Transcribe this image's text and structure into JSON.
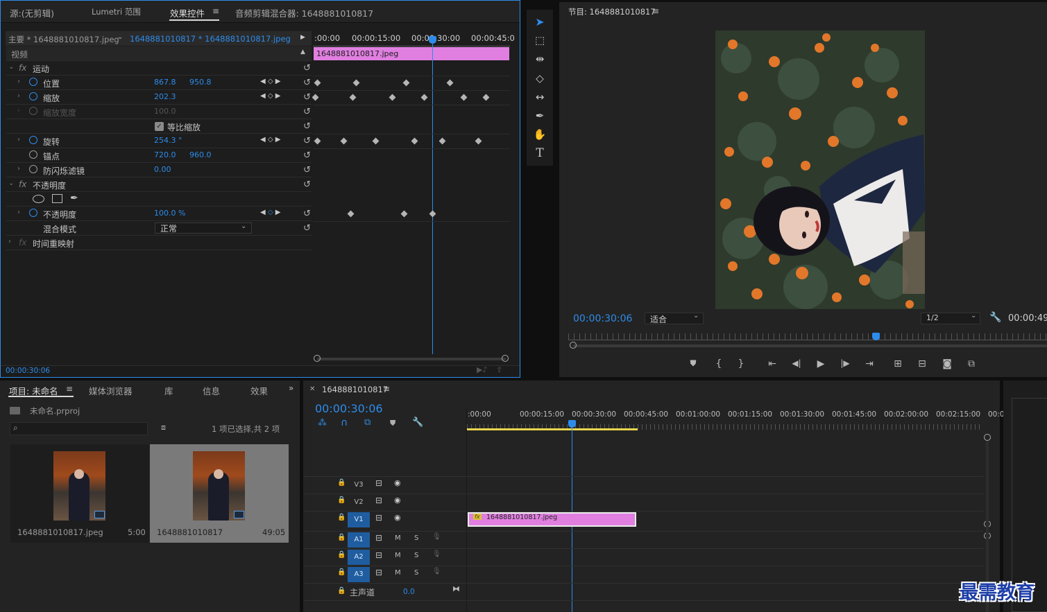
{
  "effect_panel": {
    "tabs": [
      "源:(无剪辑)",
      "Lumetri 范围",
      "效果控件",
      "音频剪辑混合器: 1648881010817"
    ],
    "active_tab": "效果控件",
    "master_label": "主要 * 1648881010817.jpeg",
    "clip_select": "1648881010817 * 1648881010817.jpeg",
    "ruler_ticks": [
      ":00:00",
      "00:00:15:00",
      "00:00:30:00",
      "00:00:45:0"
    ],
    "clip_bar": "1648881010817.jpeg",
    "video_label": "视频",
    "motion_label": "运动",
    "position_label": "位置",
    "position_x": "867.8",
    "position_y": "950.8",
    "scale_label": "缩放",
    "scale_value": "202.3",
    "scale_width_label": "缩放宽度",
    "scale_width_value": "100.0",
    "uniform_label": "等比缩放",
    "rotation_label": "旋转",
    "rotation_value": "254.3 °",
    "anchor_label": "锚点",
    "anchor_x": "720.0",
    "anchor_y": "960.0",
    "flicker_label": "防闪烁滤镜",
    "flicker_value": "0.00",
    "opacity_group": "不透明度",
    "opacity_label": "不透明度",
    "opacity_value": "100.0 %",
    "blend_label": "混合模式",
    "blend_value": "正常",
    "time_remap_label": "时间重映射",
    "timecode": "00:00:30:06"
  },
  "program_monitor": {
    "title": "节目: 1648881010817",
    "timecode": "00:00:30:06",
    "fit": "适合",
    "resolution": "1/2",
    "duration": "00:00:49"
  },
  "project_panel": {
    "tabs": [
      "项目: 未命名",
      "媒体浏览器",
      "库",
      "信息",
      "效果"
    ],
    "project_file": "未命名.prproj",
    "selection_info": "1 项已选择,共 2 项",
    "items": [
      {
        "name": "1648881010817.jpeg",
        "duration": "5:00"
      },
      {
        "name": "1648881010817",
        "duration": "49:05"
      }
    ]
  },
  "timeline": {
    "sequence_tab": "1648881010817",
    "timecode": "00:00:30:06",
    "ruler_ticks": [
      ":00:00",
      "00:00:15:00",
      "00:00:30:00",
      "00:00:45:00",
      "00:01:00:00",
      "00:01:15:00",
      "00:01:30:00",
      "00:01:45:00",
      "00:02:00:00",
      "00:02:15:00",
      "00:0"
    ],
    "video_tracks": [
      "V3",
      "V2",
      "V1"
    ],
    "audio_tracks": [
      "A1",
      "A2",
      "A3"
    ],
    "mute_label": "M",
    "solo_label": "S",
    "master_label": "主声道",
    "master_value": "0.0",
    "clip_name": "1648881010817.jpeg",
    "fx_badge": "fx"
  },
  "watermark": "最需教育",
  "colors": {
    "accent": "#2d8ceb",
    "clip": "#e07fe0",
    "panel": "#232323",
    "work_area": "#e8d44d"
  }
}
